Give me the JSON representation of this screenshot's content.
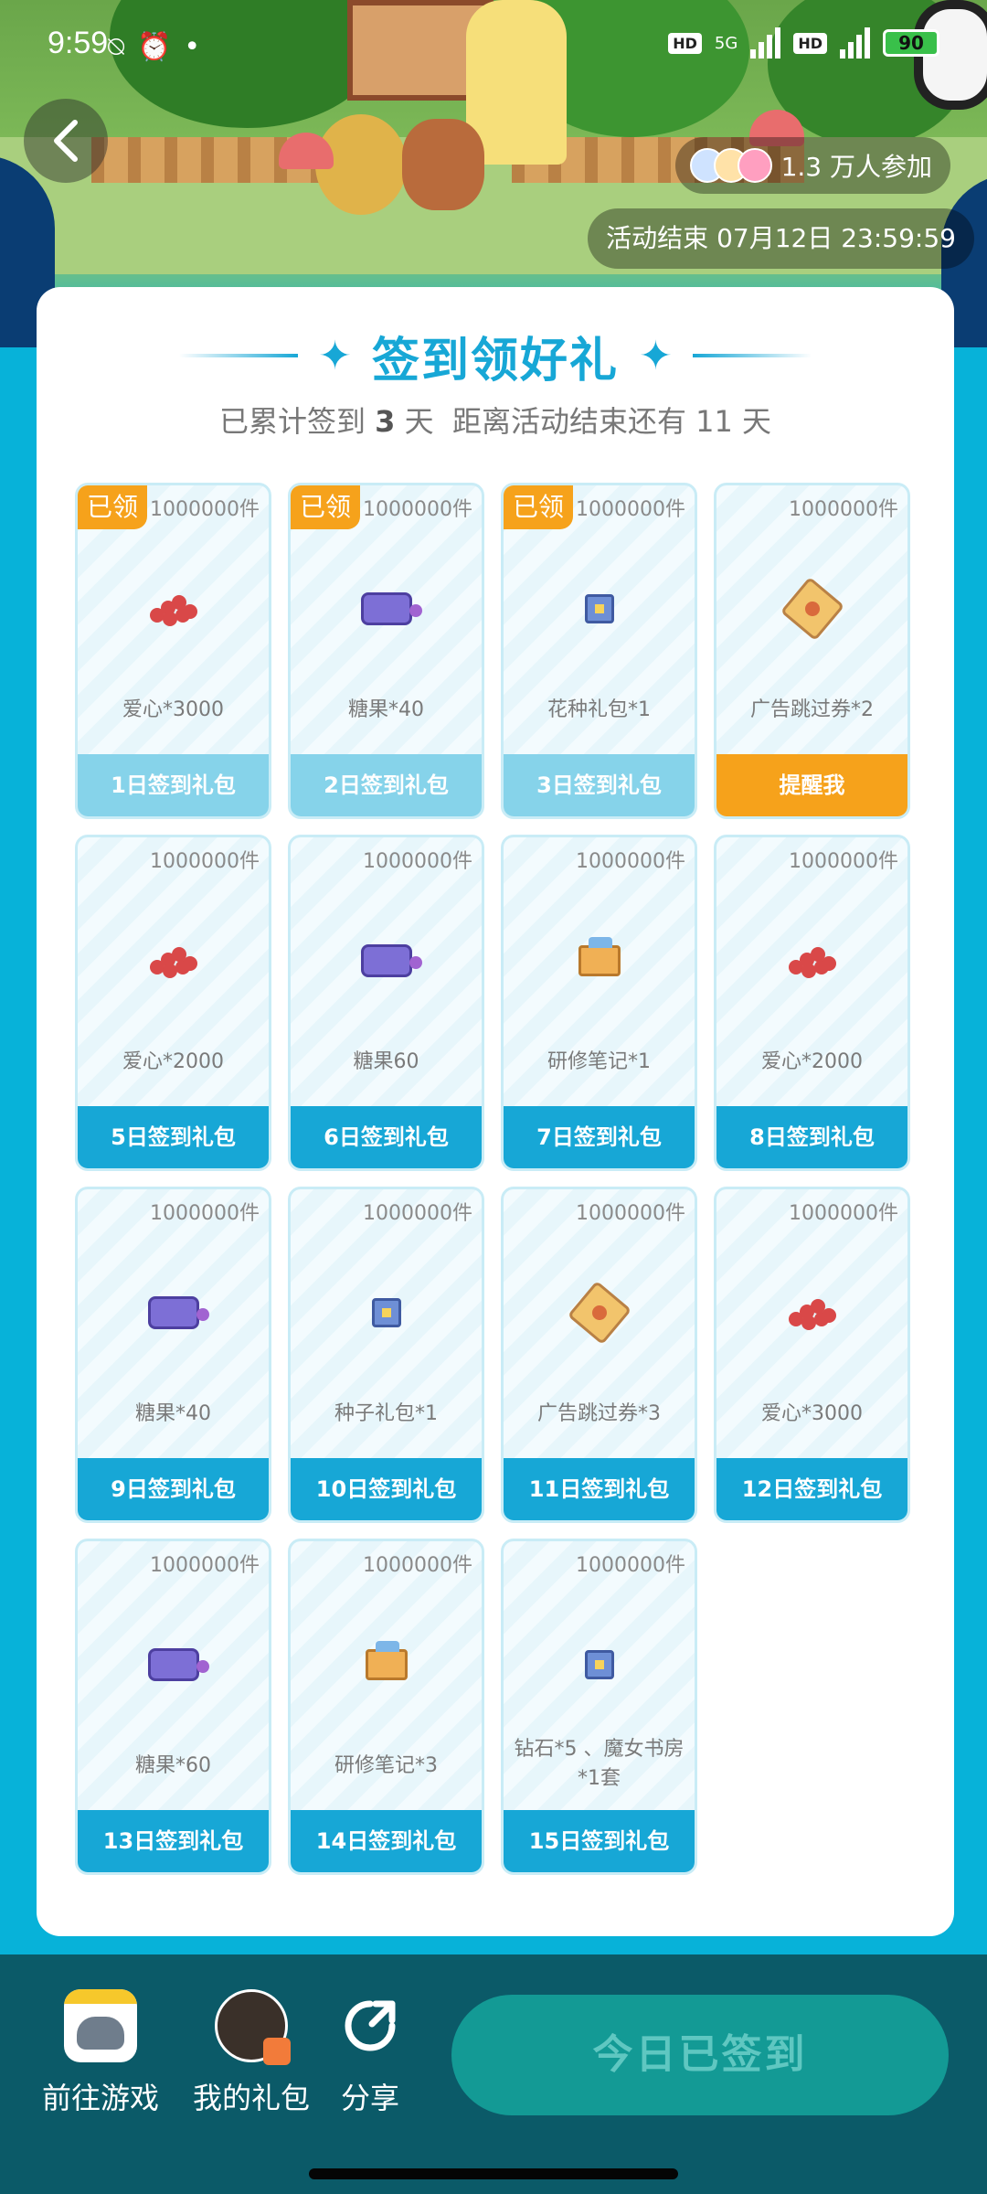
{
  "status_bar": {
    "time": "9:59",
    "battery": "90",
    "network": "5G"
  },
  "header": {
    "participants": "1.3 万人参加",
    "end_time": "活动结束 07月12日 23:59:59"
  },
  "card": {
    "title": "签到领好礼",
    "progress_prefix": "已累计签到",
    "signed_days": "3",
    "progress_mid": "天  距离活动结束还有",
    "remaining_days": "11",
    "progress_suffix": "天"
  },
  "gifts": [
    {
      "stock": "1000000件",
      "name": "爱心*3000",
      "button": "1日签到礼包",
      "claimed": "已领",
      "icon": "heart-icon"
    },
    {
      "stock": "1000000件",
      "name": "糖果*40",
      "button": "2日签到礼包",
      "claimed": "已领",
      "icon": "candy-icon"
    },
    {
      "stock": "1000000件",
      "name": "花种礼包*1",
      "button": "3日签到礼包",
      "claimed": "已领",
      "icon": "chest-icon"
    },
    {
      "stock": "1000000件",
      "name": "广告跳过券*2",
      "button": "提醒我",
      "claimed": "",
      "icon": "ticket-icon"
    },
    {
      "stock": "1000000件",
      "name": "爱心*2000",
      "button": "5日签到礼包",
      "claimed": "",
      "icon": "heart-icon"
    },
    {
      "stock": "1000000件",
      "name": "糖果60",
      "button": "6日签到礼包",
      "claimed": "",
      "icon": "candy-icon"
    },
    {
      "stock": "1000000件",
      "name": "研修笔记*1",
      "button": "7日签到礼包",
      "claimed": "",
      "icon": "book-icon"
    },
    {
      "stock": "1000000件",
      "name": "爱心*2000",
      "button": "8日签到礼包",
      "claimed": "",
      "icon": "heart-icon"
    },
    {
      "stock": "1000000件",
      "name": "糖果*40",
      "button": "9日签到礼包",
      "claimed": "",
      "icon": "candy-icon"
    },
    {
      "stock": "1000000件",
      "name": "种子礼包*1",
      "button": "10日签到礼包",
      "claimed": "",
      "icon": "chest-icon"
    },
    {
      "stock": "1000000件",
      "name": "广告跳过券*3",
      "button": "11日签到礼包",
      "claimed": "",
      "icon": "ticket-icon"
    },
    {
      "stock": "1000000件",
      "name": "爱心*3000",
      "button": "12日签到礼包",
      "claimed": "",
      "icon": "heart-icon"
    },
    {
      "stock": "1000000件",
      "name": "糖果*60",
      "button": "13日签到礼包",
      "claimed": "",
      "icon": "candy-icon"
    },
    {
      "stock": "1000000件",
      "name": "研修笔记*3",
      "button": "14日签到礼包",
      "claimed": "",
      "icon": "book-icon"
    },
    {
      "stock": "1000000件",
      "name": "钻石*5 、魔女书房*1套",
      "button": "15日签到礼包",
      "claimed": "",
      "icon": "chest-icon"
    }
  ],
  "bottom_bar": {
    "game_label": "前往游戏",
    "gift_label": "我的礼包",
    "share_label": "分享",
    "signed_button": "今日已签到"
  },
  "colors": {
    "accent": "#17a7d6",
    "claimed": "#f6a21b",
    "bottom_bar": "#0b5a68",
    "signed_button": "#139a95"
  }
}
